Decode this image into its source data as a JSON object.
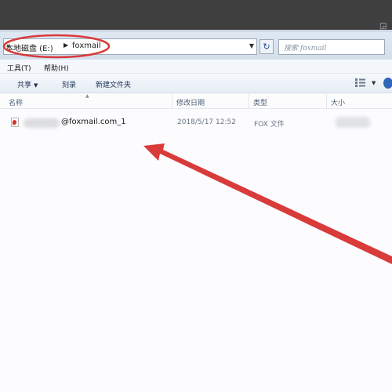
{
  "address": {
    "crumbs": [
      "本地磁盘 (E:)",
      "foxmail"
    ],
    "refresh_icon": "refresh-icon"
  },
  "search": {
    "placeholder": "搜索 foxmail"
  },
  "menu": {
    "items": [
      "工具(T)",
      "帮助(H)"
    ]
  },
  "toolbar": {
    "share_label": "共享",
    "burn_label": "刻录",
    "new_folder_label": "新建文件夹"
  },
  "columns": {
    "name": "名称",
    "date": "修改日期",
    "type": "类型",
    "size": "大小"
  },
  "files": [
    {
      "name": "@foxmail.com_1",
      "date": "2018/5/17 12:52",
      "type": "FOX 文件",
      "size": ""
    }
  ],
  "colors": {
    "annotation_red": "#d93a3a",
    "title_bar": "#3f3f40",
    "accent_blue": "#2e67b6"
  }
}
